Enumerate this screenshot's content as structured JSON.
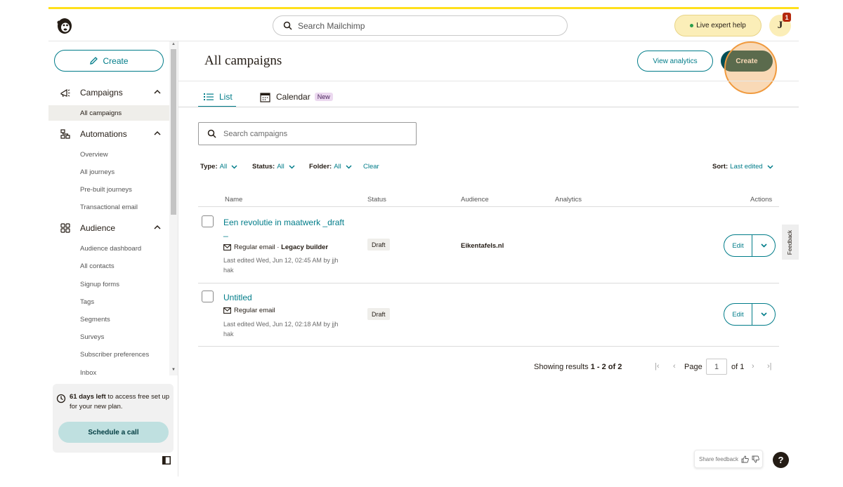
{
  "header": {
    "search_placeholder": "Search Mailchimp",
    "live_help_label": "Live expert help",
    "avatar_initial": "J",
    "notification_count": "1"
  },
  "sidebar": {
    "create_label": "Create",
    "sections": [
      {
        "label": "Campaigns",
        "icon": "megaphone-icon"
      },
      {
        "label": "Automations",
        "icon": "automation-icon"
      },
      {
        "label": "Audience",
        "icon": "audience-icon"
      }
    ],
    "campaigns_items": [
      "All campaigns"
    ],
    "automations_items": [
      "Overview",
      "All journeys",
      "Pre-built journeys",
      "Transactional email"
    ],
    "audience_items": [
      "Audience dashboard",
      "All contacts",
      "Signup forms",
      "Tags",
      "Segments",
      "Surveys",
      "Subscriber preferences",
      "Inbox"
    ],
    "trial": {
      "days_bold": "61 days left",
      "text": " to access free set up for your new plan.",
      "button": "Schedule a call"
    }
  },
  "main": {
    "title": "All campaigns",
    "view_analytics": "View analytics",
    "create_label": "Create",
    "tabs": {
      "list": "List",
      "calendar": "Calendar",
      "new_badge": "New"
    },
    "search_placeholder": "Search campaigns",
    "filters": {
      "type_label": "Type:",
      "type_value": "All",
      "status_label": "Status:",
      "status_value": "All",
      "folder_label": "Folder:",
      "folder_value": "All",
      "clear": "Clear",
      "sort_label": "Sort:",
      "sort_value": "Last edited"
    },
    "columns": [
      "Name",
      "Status",
      "Audience",
      "Analytics",
      "Actions"
    ],
    "campaigns": [
      {
        "name": "Een revolutie in maatwerk _draft",
        "name_extra": "_",
        "type": "Regular email",
        "builder": "Legacy builder",
        "edited": "Last edited Wed, Jun 12, 02:45 AM by jjh hak",
        "status": "Draft",
        "audience": "Eikentafels.nl",
        "edit": "Edit"
      },
      {
        "name": "Untitled",
        "type": "Regular email",
        "edited": "Last edited Wed, Jun 12, 02:18 AM by jjh hak",
        "status": "Draft",
        "audience": "",
        "edit": "Edit"
      }
    ],
    "feedback_tab": "Feedback",
    "pagination": {
      "showing_prefix": "Showing results ",
      "range": "1 - 2 of 2",
      "page_label": "Page",
      "page_value": "1",
      "of_label": "of 1"
    },
    "share_feedback": "Share feedback",
    "help_label": "?"
  },
  "colors": {
    "accent_yellow": "#ffe01b",
    "teal": "#007c89",
    "dark_teal": "#004e56",
    "highlight": "#f09a3e"
  }
}
